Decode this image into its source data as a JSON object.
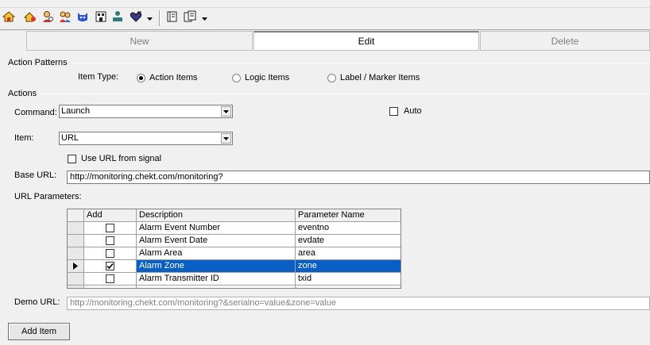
{
  "toolbar": {
    "icons": [
      "home-icon",
      "home-user-icon",
      "user-search-icon",
      "user-group-icon",
      "cat-face-icon",
      "building-icon",
      "person-desk-icon",
      "heart-icon",
      "book-icon",
      "ledger-icon"
    ]
  },
  "tabs": [
    {
      "label": "New",
      "active": false
    },
    {
      "label": "Edit",
      "active": true
    },
    {
      "label": "Delete",
      "active": false
    }
  ],
  "action_patterns": {
    "title": "Action Patterns",
    "item_type_label": "Item Type:",
    "options": [
      {
        "label": "Action Items",
        "selected": true
      },
      {
        "label": "Logic Items",
        "selected": false
      },
      {
        "label": "Label / Marker Items",
        "selected": false
      }
    ]
  },
  "actions": {
    "title": "Actions",
    "command_label": "Command:",
    "command_value": "Launch",
    "auto_label": "Auto",
    "auto_checked": false,
    "item_label": "Item:",
    "item_value": "URL",
    "use_url_label": "Use URL from signal",
    "use_url_checked": false,
    "base_url_label": "Base URL:",
    "base_url_value": "http://monitoring.chekt.com/monitoring?",
    "url_params_label": "URL Parameters:",
    "demo_url_label": "Demo URL:",
    "demo_url_value": "http://monitoring.chekt.com/monitoring?&serialno=value&zone=value",
    "add_item_label": "Add Item"
  },
  "grid": {
    "columns": [
      "Add",
      "Description",
      "Parameter Name"
    ],
    "rows": [
      {
        "checked": false,
        "description": "Alarm Event Number",
        "param": "eventno",
        "selected": false
      },
      {
        "checked": false,
        "description": "Alarm Event Date",
        "param": "evdate",
        "selected": false
      },
      {
        "checked": false,
        "description": "Alarm Area",
        "param": "area",
        "selected": false
      },
      {
        "checked": true,
        "description": "Alarm Zone",
        "param": "zone",
        "selected": true
      },
      {
        "checked": false,
        "description": "Alarm Transmitter ID",
        "param": "txid",
        "selected": false
      }
    ]
  }
}
